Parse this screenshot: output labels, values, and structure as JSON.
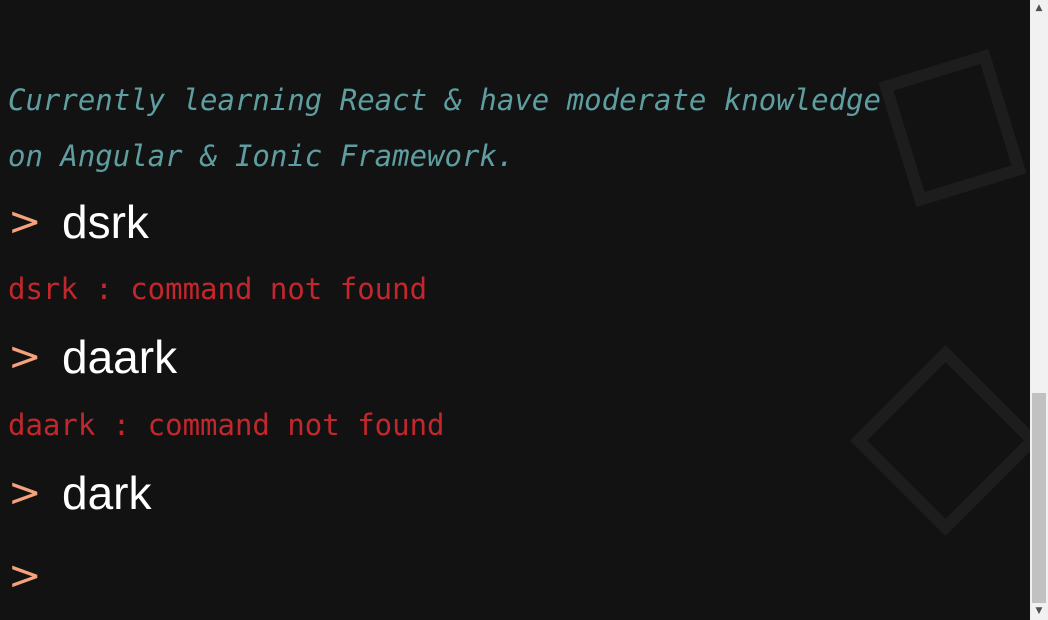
{
  "intro": {
    "line1": "Currently learning React & have moderate knowledge",
    "line2": "on Angular & Ionic Framework."
  },
  "history": [
    {
      "prompt": ">",
      "command": "dsrk",
      "output": "dsrk : command not found"
    },
    {
      "prompt": ">",
      "command": "daark",
      "output": "daark : command not found"
    },
    {
      "prompt": ">",
      "command": "dark"
    }
  ],
  "current_input": {
    "prompt": ">",
    "value": ""
  },
  "colors": {
    "background": "#121212",
    "intro_text": "#5f9ea0",
    "prompt": "#f4a27b",
    "command_text": "#ffffff",
    "error_text": "#c1272d"
  },
  "icons": {
    "scroll_up": "arrow-up-icon",
    "scroll_down": "arrow-down-icon"
  },
  "scrollbar": {
    "up_glyph": "▲",
    "down_glyph": "▼"
  }
}
